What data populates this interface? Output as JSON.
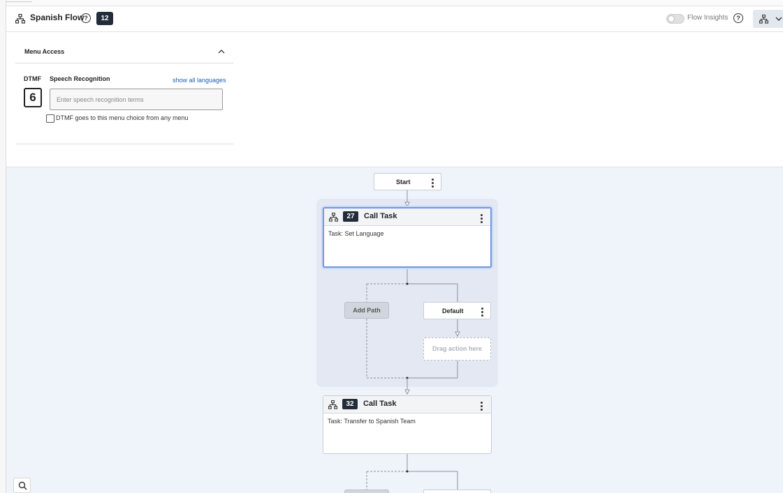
{
  "header": {
    "title": "Spanish Flow",
    "badge_count": "12",
    "flow_insights_label": "Flow Insights",
    "flow_insights_enabled": false,
    "icon": "flow-icon"
  },
  "menu_access": {
    "section_title": "Menu Access",
    "dtmf_label": "DTMF",
    "speech_label": "Speech Recognition",
    "show_all_languages": "show all languages",
    "dtmf_value": "6",
    "speech_placeholder": "Enter speech recognition terms",
    "speech_value": "",
    "global_checkbox_label": "DTMF goes to this menu choice from any menu",
    "global_checkbox_checked": false
  },
  "canvas": {
    "start_label": "Start",
    "tasks": [
      {
        "number": "27",
        "title": "Call Task",
        "body": "Task: Set Language",
        "selected": true
      },
      {
        "number": "32",
        "title": "Call Task",
        "body": "Task: Transfer to Spanish Team",
        "selected": false
      }
    ],
    "add_path_label": "Add Path",
    "default_label": "Default",
    "drag_action_label": "Drag action here"
  },
  "colors": {
    "canvas_bg": "#eff3fa",
    "group_bg": "#e3e8f3",
    "selected_border": "#6e98e1",
    "badge_bg": "#222c3a",
    "link": "#1a5fb4"
  }
}
